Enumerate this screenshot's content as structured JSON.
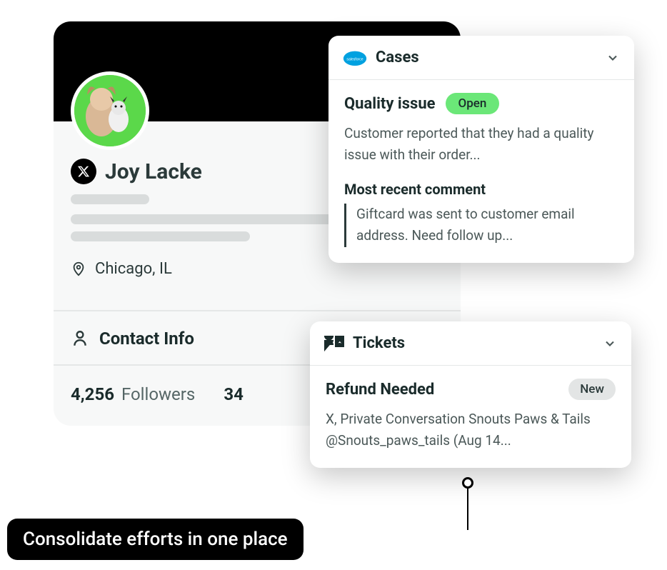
{
  "profile": {
    "name": "Joy Lacke",
    "location": "Chicago, IL",
    "contact_info_label": "Contact Info",
    "followers_count": "4,256",
    "followers_label": "Followers",
    "following_count_partial": "34"
  },
  "cases": {
    "header": "Cases",
    "title": "Quality issue",
    "status": "Open",
    "description": "Customer reported that they had a quality issue with their order...",
    "comment_heading": "Most recent comment",
    "comment_text": "Giftcard was sent to customer email address. Need follow up..."
  },
  "tickets": {
    "header": "Tickets",
    "title": "Refund Needed",
    "status": "New",
    "description": "X, Private Conversation Snouts Paws & Tails @Snouts_paws_tails (Aug 14..."
  },
  "caption": "Consolidate efforts in one place"
}
